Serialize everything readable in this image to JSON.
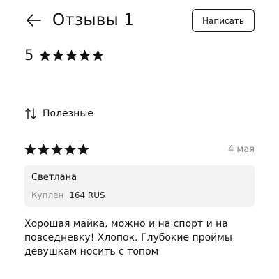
{
  "header": {
    "title": "Отзывы 1",
    "write_label": "Написать",
    "back_icon": "arrow-left-icon"
  },
  "summary": {
    "rating": "5",
    "stars_filled": 5,
    "stars_total": 5
  },
  "sort": {
    "label": "Полезные",
    "icon": "sort-icon"
  },
  "review": {
    "stars_filled": 5,
    "date": "4 мая",
    "author": "Светлана",
    "bought_label": "Куплен",
    "bought_value": "164 RUS",
    "text": "Хорошая майка, можно и на спорт и на повседневку! Хлопок. Глубокие проймы девушкам носить с топом"
  },
  "colors": {
    "text": "#111111",
    "muted": "#8a8a8a",
    "card_bg": "#f3f3f3"
  }
}
